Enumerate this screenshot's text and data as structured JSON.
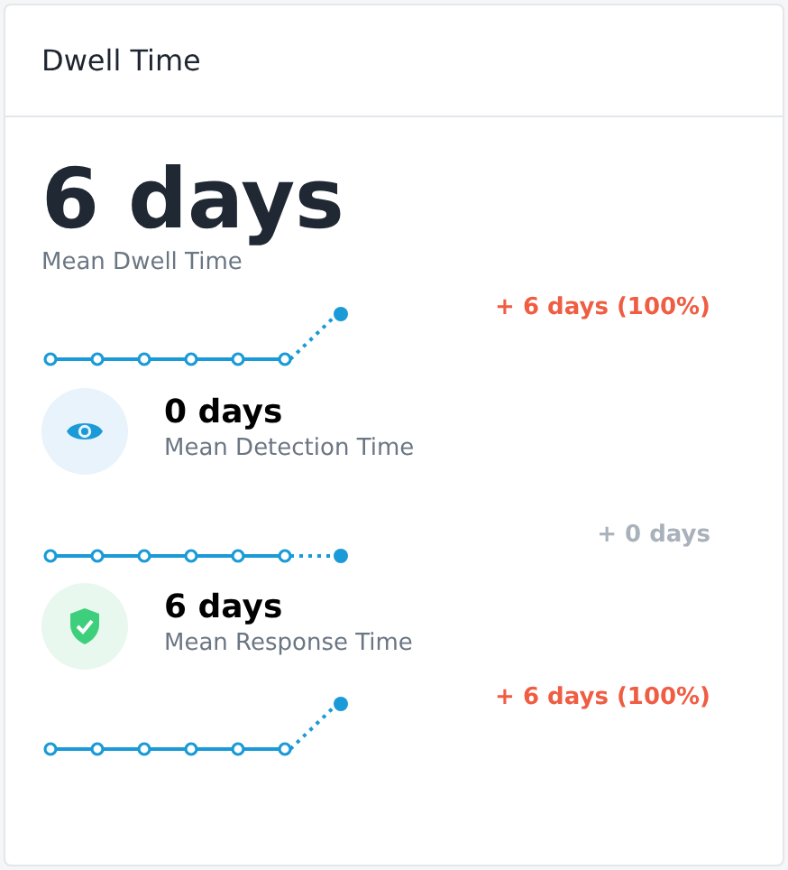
{
  "card": {
    "title": "Dwell Time"
  },
  "summary": {
    "value": "6 days",
    "label": "Mean Dwell Time",
    "increased": true,
    "change": "+ 6 days (100%)"
  },
  "metrics": [
    {
      "kind": "detection",
      "value": "0 days",
      "label": "Mean Detection Time",
      "increased": false,
      "change": "+ 0 days"
    },
    {
      "kind": "response",
      "value": "6 days",
      "label": "Mean Response Time",
      "increased": true,
      "change": "+ 6 days (100%)"
    }
  ]
}
